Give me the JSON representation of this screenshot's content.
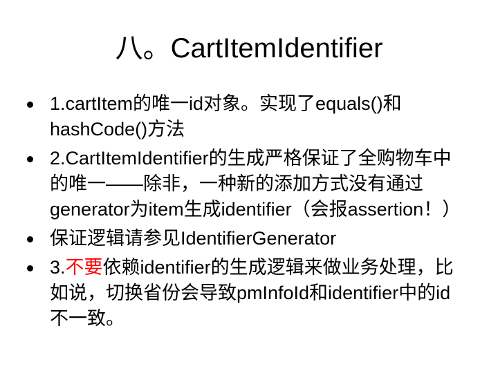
{
  "title": "八。CartItemIdentifier",
  "colors": {
    "text": "#000000",
    "highlight": "#ff0000",
    "background": "#ffffff"
  },
  "bullets": [
    {
      "text": "1.cartItem的唯一id对象。实现了equals()和hashCode()方法"
    },
    {
      "text": "2.CartItemIdentifier的生成严格保证了全购物车中的唯一——除非，一种新的添加方式没有通过generator为item生成identifier（会报assertion！）"
    },
    {
      "text": "保证逻辑请参见IdentifierGenerator"
    },
    {
      "prefix": "3.",
      "highlight": "不要",
      "suffix": "依赖identifier的生成逻辑来做业务处理，比如说，切换省份会导致pmInfoId和identifier中的id不一致。"
    }
  ]
}
